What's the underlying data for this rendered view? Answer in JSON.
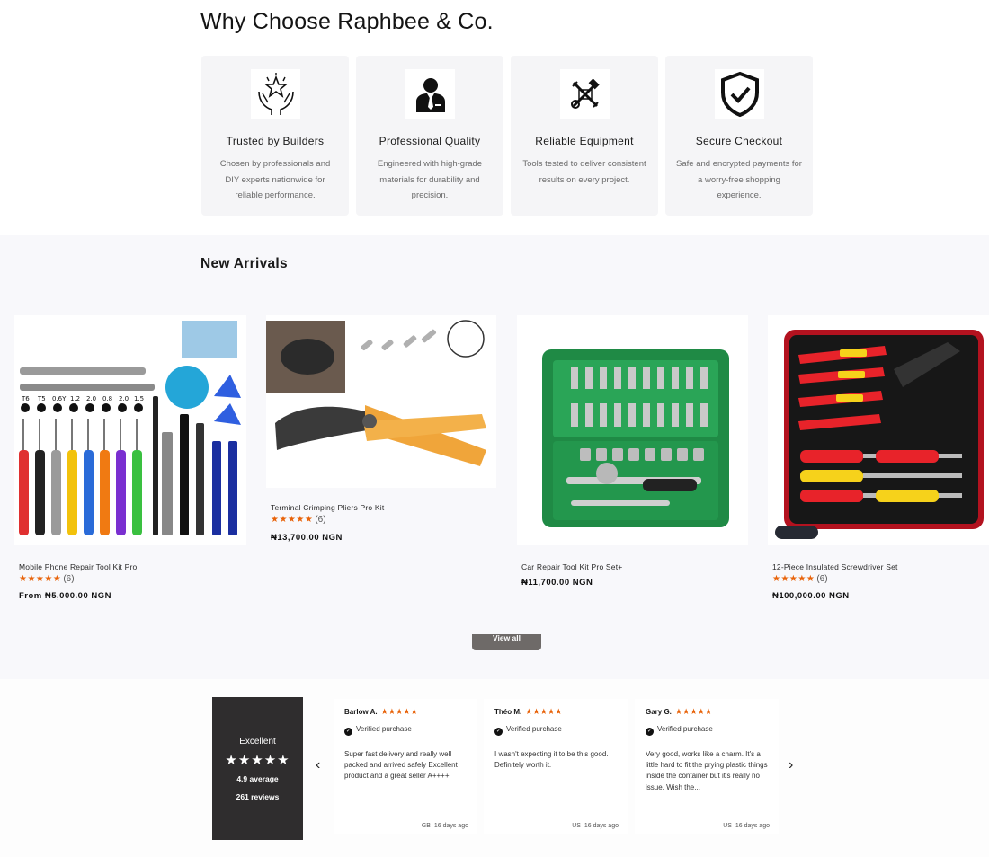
{
  "why": {
    "title": "Why Choose Raphbee & Co.",
    "features": [
      {
        "icon": "hands-star-icon",
        "title": "Trusted by Builders",
        "desc": "Chosen by professionals and DIY experts nationwide for reliable performance."
      },
      {
        "icon": "professional-person-icon",
        "title": "Professional Quality",
        "desc": "Engineered with high-grade materials for durability and precision."
      },
      {
        "icon": "tools-icon",
        "title": "Reliable Equipment",
        "desc": "Tools tested to deliver consistent results on every project."
      },
      {
        "icon": "shield-check-icon",
        "title": "Secure Checkout",
        "desc": "Safe and encrypted payments for a worry-free shopping experience."
      }
    ]
  },
  "arrivals": {
    "title": "New Arrivals",
    "view_all": "View all",
    "products": [
      {
        "name": "Mobile Phone Repair Tool Kit Pro",
        "stars": "★★★★★",
        "count": "(6)",
        "price": "From ₦5,000.00 NGN"
      },
      {
        "name": "Terminal Crimping Pliers Pro Kit",
        "stars": "★★★★★",
        "count": "(6)",
        "price": "₦13,700.00 NGN"
      },
      {
        "name": "Car Repair Tool Kit Pro Set+",
        "price": "₦11,700.00 NGN"
      },
      {
        "name": "12-Piece Insulated Screwdriver Set",
        "stars": "★★★★★",
        "count": "(6)",
        "price": "₦100,000.00 NGN"
      }
    ]
  },
  "reviews": {
    "summary": {
      "label": "Excellent",
      "stars": "★★★★★",
      "average": "4.9 average",
      "count": "261 reviews"
    },
    "prev": "‹",
    "next": "›",
    "items": [
      {
        "name": "Barlow A.",
        "stars": "★★★★★",
        "verified": "Verified purchase",
        "text": "Super fast delivery and really well packed and arrived safely Excellent product and a great seller A++++",
        "country": "GB",
        "age": "16 days ago"
      },
      {
        "name": "Théo M.",
        "stars": "★★★★★",
        "verified": "Verified purchase",
        "text": "I wasn't expecting it to be this good. Definitely worth it.",
        "country": "US",
        "age": "16 days ago"
      },
      {
        "name": "Gary G.",
        "stars": "★★★★★",
        "verified": "Verified purchase",
        "text": "Very good, works like a charm. It's a little hard to fit the prying plastic things inside the container but it's really no issue. Wish the...",
        "country": "US",
        "age": "16 days ago"
      }
    ]
  }
}
